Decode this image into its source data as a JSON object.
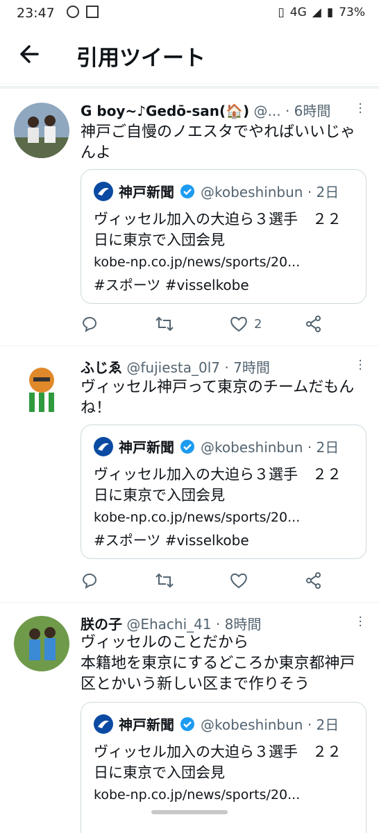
{
  "status_bar": {
    "time": "23:47",
    "network": "4G",
    "battery": "73%"
  },
  "header": {
    "title": "引用ツイート"
  },
  "tweets": [
    {
      "name": "G boy~♪Gedō-san(🏠)",
      "handle": "@...",
      "time": "· 6時間",
      "text": "神戸ご自慢のノエスタでやればいいじゃんよ",
      "likes": "2",
      "quote": {
        "name": "神戸新聞",
        "handle": "@kobeshinbun · 2日",
        "text": "ヴィッセル加入の大迫ら３選手　２２日に東京で入団会見",
        "url": "kobe-np.co.jp/news/sports/20...",
        "tags": "#スポーツ #visselkobe"
      }
    },
    {
      "name": "ふじゑ",
      "handle": "@fujiesta_0l7",
      "time": "· 7時間",
      "text": "ヴィッセル神戸って東京のチームだもんね！",
      "likes": "",
      "quote": {
        "name": "神戸新聞",
        "handle": "@kobeshinbun · 2日",
        "text": "ヴィッセル加入の大迫ら３選手　２２日に東京で入団会見",
        "url": "kobe-np.co.jp/news/sports/20...",
        "tags": "#スポーツ #visselkobe"
      }
    },
    {
      "name": "朕の子",
      "handle": "@Ehachi_41",
      "time": "· 8時間",
      "text": "ヴィッセルのことだから\n本籍地を東京にするどころか東京都神戸区とかいう新しい区まで作りそう",
      "quote": {
        "name": "神戸新聞",
        "handle": "@kobeshinbun · 2日",
        "text": "ヴィッセル加入の大迫ら３選手　２２日に東京で入団会見",
        "url": "kobe-np.co.jp/news/sports/20..."
      }
    }
  ],
  "icons": [
    "back-arrow-icon",
    "more-icon",
    "reply-icon",
    "retweet-icon",
    "like-icon",
    "share-icon",
    "verified-icon"
  ],
  "colors": {
    "text": "#0f1419",
    "secondary": "#536471",
    "verified": "#1d9bf0",
    "border": "#cfd9de"
  }
}
